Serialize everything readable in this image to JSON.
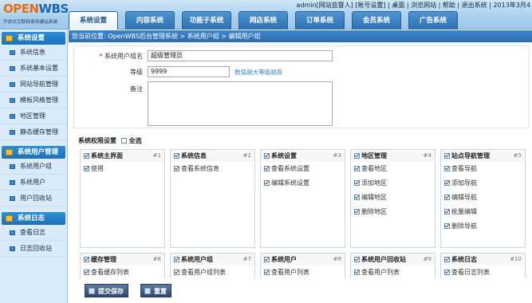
{
  "brand": {
    "logo_a": "OPEN",
    "logo_b": "WBS",
    "tagline": "开放式互联网商务建站系统"
  },
  "top_links": "admin[网站监督人] [帐号设置] | 桌面 | 浏览网站 | 帮助 | 退出系统 | 2013年3月4",
  "top_nav": [
    {
      "label": "系统设置",
      "active": true
    },
    {
      "label": "内容系统",
      "active": false
    },
    {
      "label": "功能子系统",
      "active": false
    },
    {
      "label": "网店系统",
      "active": false
    },
    {
      "label": "订单系统",
      "active": false
    },
    {
      "label": "会员系统",
      "active": false
    },
    {
      "label": "广告系统",
      "active": false
    }
  ],
  "sidebar": {
    "groups": [
      {
        "title": "系统设置",
        "items": [
          "系统信息",
          "系统基本设置",
          "网站导航管理",
          "模板风格管理",
          "地区管理",
          "静态缓存管理"
        ]
      },
      {
        "title": "系统用户管理",
        "items": [
          "系统用户组",
          "系统用户",
          "用户回收站"
        ]
      },
      {
        "title": "系统日志",
        "items": [
          "查看日志",
          "日志回收站"
        ]
      }
    ]
  },
  "breadcrumb": "您当前位置: OpenWBS后台管理系统 > 系统用户组 > 编辑用户组",
  "form": {
    "name_label": "系统用户组名",
    "name_value": "超级管理员",
    "level_label": "等级",
    "level_value": "9999",
    "level_tip": "数值越大等级越高",
    "note_label": "备注",
    "note_value": ""
  },
  "permissions": {
    "title": "系统权限设置",
    "select_all": "全选",
    "cards": [
      {
        "title": "系统主界面",
        "num": "#1",
        "items": [
          "使用"
        ]
      },
      {
        "title": "系统信息",
        "num": "#2",
        "items": [
          "查看系统信息"
        ]
      },
      {
        "title": "系统设置",
        "num": "#3",
        "items": [
          "查看系统设置",
          "编辑系统设置"
        ]
      },
      {
        "title": "地区管理",
        "num": "#4",
        "items": [
          "查看地区",
          "添加地区",
          "编辑地区",
          "删除地区"
        ]
      },
      {
        "title": "站点导航管理",
        "num": "#5",
        "items": [
          "查看导航",
          "添加导航",
          "编辑导航",
          "批量编辑",
          "删除导航"
        ]
      },
      {
        "title": "缓存管理",
        "num": "#6",
        "items": [
          "查看缓存列表"
        ]
      },
      {
        "title": "系统用户组",
        "num": "#7",
        "items": [
          "查看用户组列表"
        ]
      },
      {
        "title": "系统用户",
        "num": "#8",
        "items": [
          "查看用户列表"
        ]
      },
      {
        "title": "系统用户回收站",
        "num": "#9",
        "items": [
          "查看用户列表"
        ]
      },
      {
        "title": "系统日志",
        "num": "#10",
        "items": [
          "查看日志列表"
        ]
      }
    ]
  },
  "buttons": {
    "save": "提交保存",
    "reset": "重置"
  }
}
